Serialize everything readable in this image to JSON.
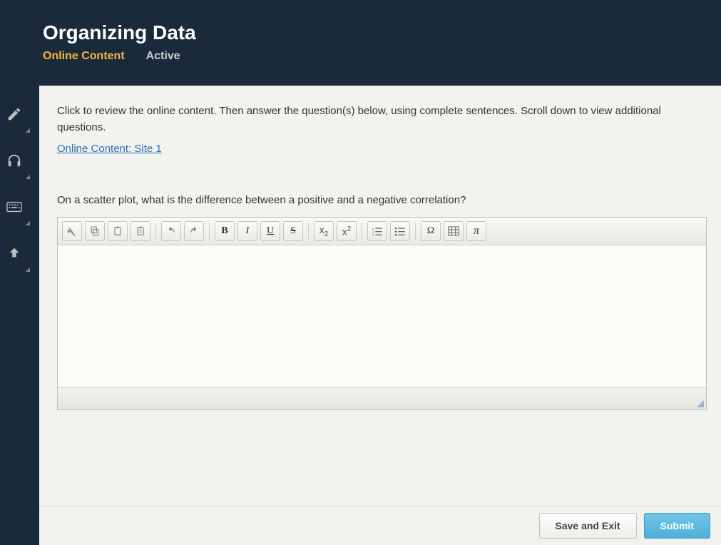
{
  "header": {
    "title": "Organizing Data",
    "tabs": [
      {
        "label": "Online Content",
        "active": true
      },
      {
        "label": "Active",
        "active": false
      }
    ]
  },
  "sidebar": {
    "items": [
      "pencil",
      "headphones",
      "keyboard",
      "upload"
    ]
  },
  "content": {
    "instructions": "Click to review the online content. Then answer the question(s) below, using complete sentences. Scroll down to view additional questions.",
    "link_text": "Online Content: Site 1",
    "question": "On a scatter plot, what is the difference between a positive and a negative correlation?"
  },
  "editor": {
    "toolbar": {
      "cut": "✂",
      "copy": "⧉",
      "paste": "📋",
      "paste_plain": "📋",
      "undo": "↶",
      "redo": "↷",
      "bold": "B",
      "italic": "I",
      "underline": "U",
      "strike": "S",
      "subscript_base": "x",
      "subscript_sub": "2",
      "superscript_base": "x",
      "superscript_sup": "2",
      "ordered_list": "≣",
      "unordered_list": "•≡",
      "omega": "Ω",
      "table": "⊞",
      "pi": "π"
    },
    "value": ""
  },
  "footer": {
    "save_exit": "Save and Exit",
    "submit": "Submit"
  }
}
